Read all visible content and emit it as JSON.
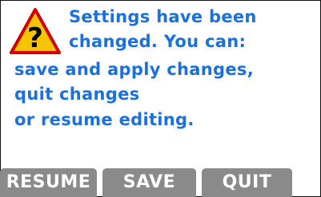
{
  "dialog": {
    "icon": "warning-question-icon",
    "icon_glyph": "?",
    "lines": [
      "Settings have been",
      "changed. You can:",
      "save and apply changes,",
      "quit changes",
      "or resume editing."
    ]
  },
  "softkeys": {
    "resume": "RESUME",
    "save": "SAVE",
    "quit": "QUIT"
  },
  "colors": {
    "text": "#1a70e0",
    "softkey_bg": "#8a8a8a",
    "warning_fill": "#f6c400",
    "warning_border": "#d40000"
  }
}
